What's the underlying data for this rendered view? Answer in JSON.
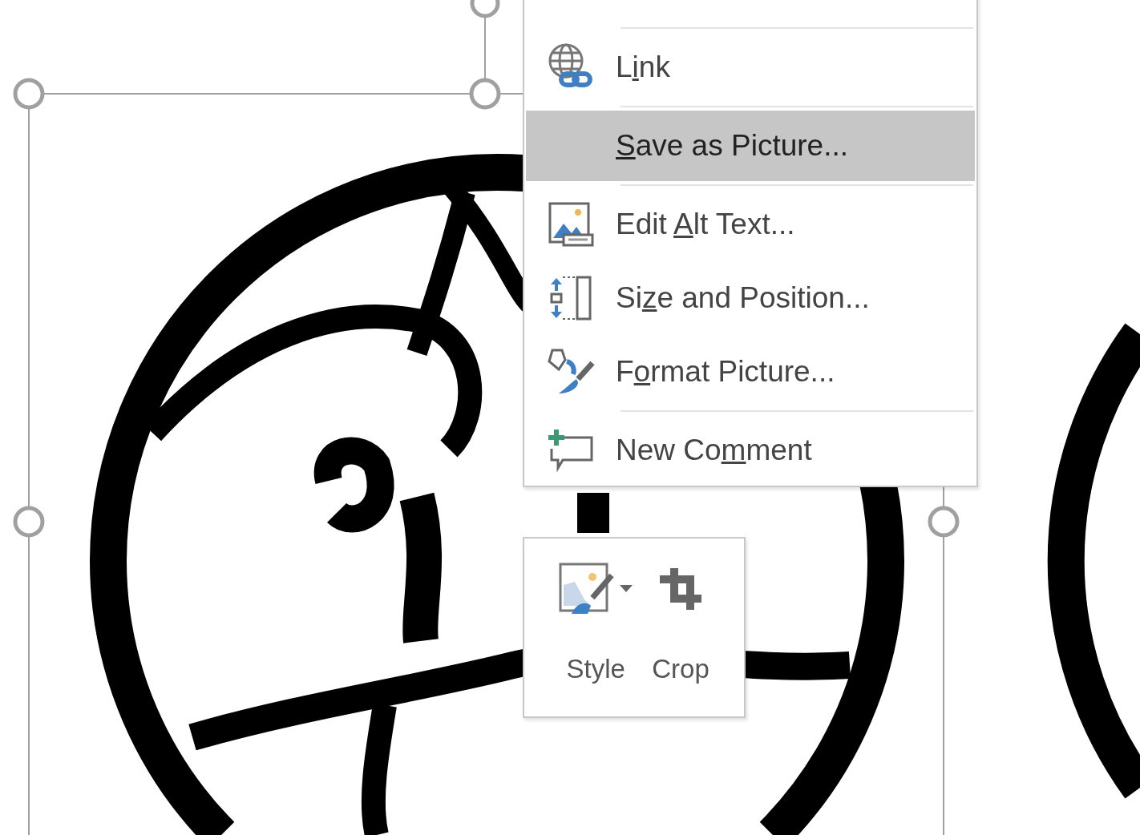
{
  "context_menu": {
    "items": [
      {
        "kind": "link",
        "label_before": "L",
        "mnemonic": "i",
        "label_after": "nk",
        "selected": false,
        "separator_before": true
      },
      {
        "kind": "plain",
        "mnemonic": "S",
        "label_after": "ave as Picture...",
        "selected": true,
        "separator_before": true
      },
      {
        "kind": "alt",
        "label_before": "Edit ",
        "mnemonic": "A",
        "label_after": "lt Text...",
        "selected": false,
        "separator_before": true
      },
      {
        "kind": "size",
        "label_before": "Si",
        "mnemonic": "z",
        "label_after": "e and Position...",
        "selected": false,
        "separator_before": false
      },
      {
        "kind": "format",
        "label_before": "F",
        "mnemonic": "o",
        "label_after": "rmat Picture...",
        "selected": false,
        "separator_before": false
      },
      {
        "kind": "comment",
        "label_before": "New Co",
        "mnemonic": "m",
        "label_after": "ment",
        "selected": false,
        "separator_before": true
      }
    ]
  },
  "mini_toolbar": {
    "buttons": [
      {
        "kind": "style",
        "label": "Style",
        "has_dropdown": true
      },
      {
        "kind": "crop",
        "label": "Crop",
        "has_dropdown": false
      }
    ]
  }
}
